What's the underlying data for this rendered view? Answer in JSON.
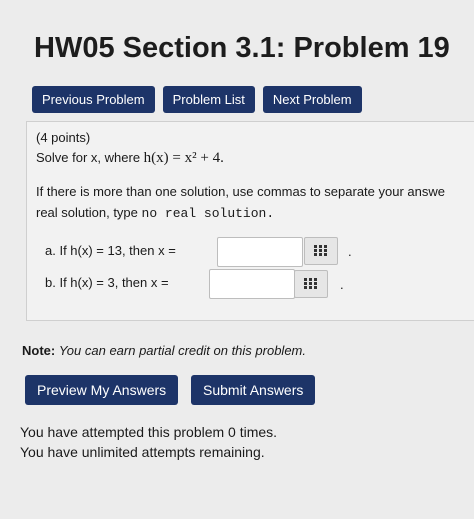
{
  "page": {
    "title": "HW05 Section 3.1: Problem 19"
  },
  "nav": {
    "previous": "Previous Problem",
    "list": "Problem List",
    "next": "Next Problem"
  },
  "problem": {
    "points": "(4 points)",
    "solve_prefix": "Solve for x, where ",
    "solve_math": "h(x) = x² + 4.",
    "instructions_line1": "If there is more than one solution, use commas to separate your answe",
    "instructions_line2_prefix": "real solution, type ",
    "instructions_line2_code": "no real solution.",
    "part_a": "a.  If h(x) = 13, then x =",
    "part_b": "b.  If h(x) = 3, then x =",
    "answer_a_value": "",
    "answer_b_value": "",
    "period": "."
  },
  "note": {
    "label": "Note:",
    "text": "You can earn partial credit on this problem."
  },
  "actions": {
    "preview": "Preview My Answers",
    "submit": "Submit Answers"
  },
  "status": {
    "attempts": "You have attempted this problem 0 times.",
    "remaining": "You have unlimited attempts remaining."
  }
}
